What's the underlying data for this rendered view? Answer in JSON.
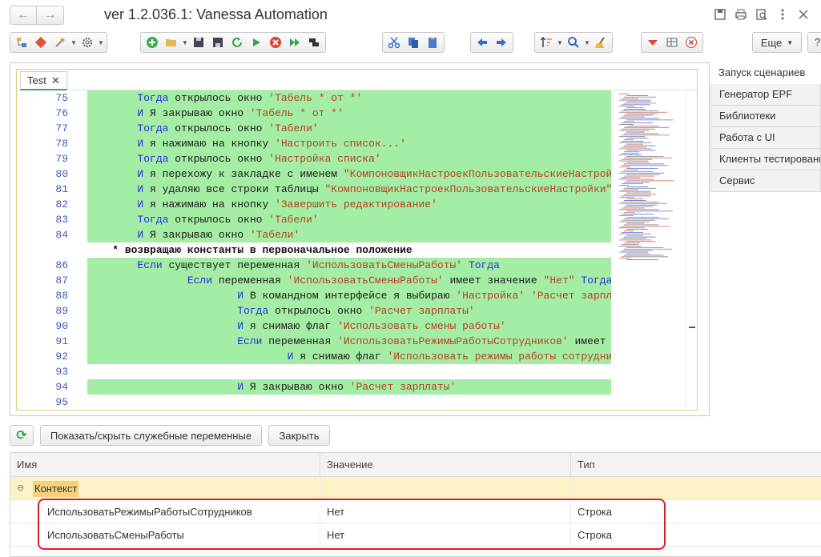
{
  "window": {
    "title": "ver 1.2.036.1: Vanessa Automation",
    "back_glyph": "←",
    "forward_glyph": "→"
  },
  "toolbar": {
    "more_label": "Еще",
    "help_label": "?"
  },
  "editor": {
    "tab_label": "Test",
    "tab_close": "✕",
    "lines": [
      {
        "num": "75",
        "hl": true,
        "parts": [
          [
            "sp",
            "        "
          ],
          [
            "kw",
            "Тогда"
          ],
          [
            "tx",
            " открылось окно "
          ],
          [
            "st",
            "'Табель * от *'"
          ]
        ]
      },
      {
        "num": "76",
        "hl": true,
        "parts": [
          [
            "sp",
            "        "
          ],
          [
            "kw",
            "И"
          ],
          [
            "tx",
            " Я закрываю окно "
          ],
          [
            "st",
            "'Табель * от *'"
          ]
        ]
      },
      {
        "num": "77",
        "hl": true,
        "parts": [
          [
            "sp",
            "        "
          ],
          [
            "kw",
            "Тогда"
          ],
          [
            "tx",
            " открылось окно "
          ],
          [
            "st",
            "'Табели'"
          ]
        ]
      },
      {
        "num": "78",
        "hl": true,
        "parts": [
          [
            "sp",
            "        "
          ],
          [
            "kw",
            "И"
          ],
          [
            "tx",
            " я нажимаю на кнопку "
          ],
          [
            "st",
            "'Настроить список...'"
          ]
        ]
      },
      {
        "num": "79",
        "hl": true,
        "parts": [
          [
            "sp",
            "        "
          ],
          [
            "kw",
            "Тогда"
          ],
          [
            "tx",
            " открылось окно "
          ],
          [
            "st",
            "'Настройка списка'"
          ]
        ]
      },
      {
        "num": "80",
        "hl": true,
        "parts": [
          [
            "sp",
            "        "
          ],
          [
            "kw",
            "И"
          ],
          [
            "tx",
            " я перехожу к закладке с именем "
          ],
          [
            "st",
            "\"КомпоновщикНастроекПользовательскиеНастройки\""
          ]
        ]
      },
      {
        "num": "81",
        "hl": true,
        "parts": [
          [
            "sp",
            "        "
          ],
          [
            "kw",
            "И"
          ],
          [
            "tx",
            " я удаляю все строки таблицы "
          ],
          [
            "st",
            "\"КомпоновщикНастроекПользовательскиеНастройки\""
          ]
        ]
      },
      {
        "num": "82",
        "hl": true,
        "parts": [
          [
            "sp",
            "        "
          ],
          [
            "kw",
            "И"
          ],
          [
            "tx",
            " я нажимаю на кнопку "
          ],
          [
            "st",
            "'Завершить редактирование'"
          ]
        ]
      },
      {
        "num": "83",
        "hl": true,
        "parts": [
          [
            "sp",
            "        "
          ],
          [
            "kw",
            "Тогда"
          ],
          [
            "tx",
            " открылось окно "
          ],
          [
            "st",
            "'Табели'"
          ]
        ]
      },
      {
        "num": "84",
        "hl": true,
        "parts": [
          [
            "sp",
            "        "
          ],
          [
            "kw",
            "И"
          ],
          [
            "tx",
            " Я закрываю окно "
          ],
          [
            "st",
            "'Табели'"
          ]
        ]
      },
      {
        "num": "",
        "hl": false,
        "parts": [
          [
            "sp",
            "    "
          ],
          [
            "bold",
            "* возвращаю константы в первоначальное положение"
          ]
        ]
      },
      {
        "num": "86",
        "hl": true,
        "parts": [
          [
            "sp",
            "        "
          ],
          [
            "kw",
            "Если"
          ],
          [
            "tx",
            " существует переменная "
          ],
          [
            "st",
            "'ИспользоватьСменыРаботы'"
          ],
          [
            "tx",
            " "
          ],
          [
            "kw",
            "Тогда"
          ]
        ]
      },
      {
        "num": "87",
        "hl": true,
        "parts": [
          [
            "sp",
            "                "
          ],
          [
            "kw",
            "Если"
          ],
          [
            "tx",
            " переменная "
          ],
          [
            "st",
            "'ИспользоватьСменыРаботы'"
          ],
          [
            "tx",
            " имеет значение "
          ],
          [
            "st",
            "\"Нет\""
          ],
          [
            "tx",
            " "
          ],
          [
            "kw",
            "Тогда"
          ]
        ]
      },
      {
        "num": "88",
        "hl": true,
        "parts": [
          [
            "sp",
            "                        "
          ],
          [
            "kw",
            "И"
          ],
          [
            "tx",
            " В командном интерфейсе я выбираю "
          ],
          [
            "st",
            "'Настройка'"
          ],
          [
            "tx",
            " "
          ],
          [
            "st",
            "'Расчет зарплаты'"
          ]
        ]
      },
      {
        "num": "89",
        "hl": true,
        "parts": [
          [
            "sp",
            "                        "
          ],
          [
            "kw",
            "Тогда"
          ],
          [
            "tx",
            " открылось окно "
          ],
          [
            "st",
            "'Расчет зарплаты'"
          ]
        ]
      },
      {
        "num": "90",
        "hl": true,
        "parts": [
          [
            "sp",
            "                        "
          ],
          [
            "kw",
            "И"
          ],
          [
            "tx",
            " я снимаю флаг "
          ],
          [
            "st",
            "'Использовать смены работы'"
          ]
        ]
      },
      {
        "num": "91",
        "hl": true,
        "parts": [
          [
            "sp",
            "                        "
          ],
          [
            "kw",
            "Если"
          ],
          [
            "tx",
            " переменная "
          ],
          [
            "st",
            "'ИспользоватьРежимыРаботыСотрудников'"
          ],
          [
            "tx",
            " имеет значение"
          ]
        ]
      },
      {
        "num": "92",
        "hl": true,
        "parts": [
          [
            "sp",
            "                                "
          ],
          [
            "kw",
            "И"
          ],
          [
            "tx",
            " я снимаю флаг "
          ],
          [
            "st",
            "'Использовать режимы работы сотрудников'"
          ]
        ]
      },
      {
        "num": "93",
        "hl": false,
        "parts": []
      },
      {
        "num": "94",
        "hl": true,
        "parts": [
          [
            "sp",
            "                        "
          ],
          [
            "kw",
            "И"
          ],
          [
            "tx",
            " Я закрываю окно "
          ],
          [
            "st",
            "'Расчет зарплаты'"
          ]
        ]
      },
      {
        "num": "95",
        "hl": false,
        "parts": []
      }
    ]
  },
  "right_panel": {
    "items": [
      {
        "label": "Запуск сценариев",
        "active": true
      },
      {
        "label": "Генератор EPF",
        "active": false
      },
      {
        "label": "Библиотеки",
        "active": false
      },
      {
        "label": "Работа с UI",
        "active": false
      },
      {
        "label": "Клиенты тестирования",
        "active": false
      },
      {
        "label": "Сервис",
        "active": false
      }
    ]
  },
  "bottom": {
    "refresh_glyph": "⟳",
    "toggle_label": "Показать/скрыть служебные переменные",
    "close_label": "Закрыть"
  },
  "table": {
    "headers": {
      "name": "Имя",
      "value": "Значение",
      "type": "Тип"
    },
    "group": {
      "label": "Контекст",
      "toggle": "⊖"
    },
    "rows": [
      {
        "name": "ИспользоватьРежимыРаботыСотрудников",
        "value": "Нет",
        "type": "Строка"
      },
      {
        "name": "ИспользоватьСменыРаботы",
        "value": "Нет",
        "type": "Строка"
      }
    ]
  },
  "colors": {
    "highlight": "#a4eda4",
    "keyword": "#2430e0",
    "string": "#b7411f",
    "line_number": "#3a5bbf",
    "group_row": "#fcf2c6",
    "callout_border": "#d91e2b"
  }
}
